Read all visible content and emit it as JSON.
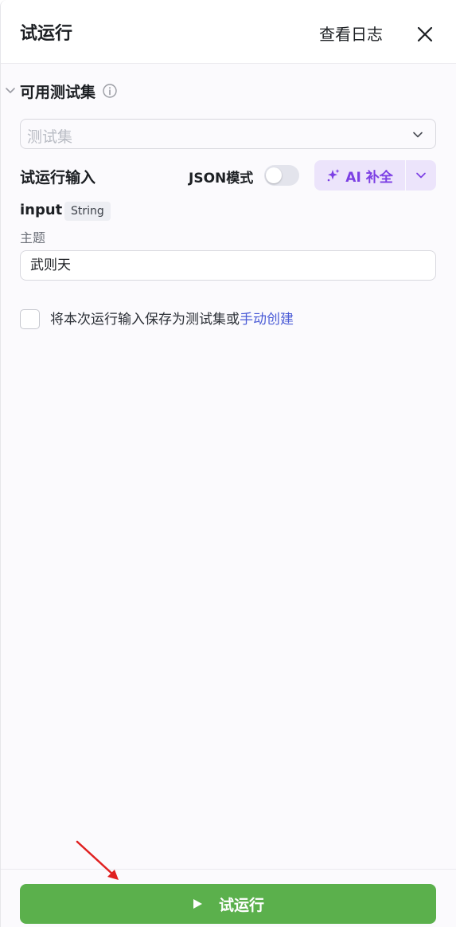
{
  "header": {
    "title": "试运行",
    "view_log": "查看日志"
  },
  "test_set": {
    "section_title": "可用测试集",
    "placeholder": "测试集"
  },
  "run_input": {
    "label": "试运行输入",
    "json_mode_label": "JSON模式",
    "json_mode_on": false,
    "ai_complete_label": "AI 补全"
  },
  "field": {
    "name": "input",
    "type": "String",
    "description": "主题",
    "value": "武则天"
  },
  "save_option": {
    "text": "将本次运行输入保存为测试集或",
    "link": "手动创建",
    "checked": false
  },
  "footer": {
    "run_label": "试运行"
  },
  "colors": {
    "primary_green": "#5bb04c",
    "ai_purple": "#7c3fe4",
    "link_blue": "#4a5bd6",
    "annotation_red": "#e02020"
  }
}
